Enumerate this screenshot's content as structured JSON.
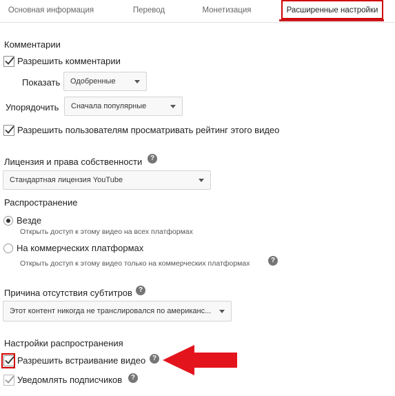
{
  "tabs": [
    {
      "label": "Основная информация"
    },
    {
      "label": "Перевод"
    },
    {
      "label": "Монетизация"
    },
    {
      "label": "Расширенные настройки"
    }
  ],
  "comments": {
    "heading": "Комментарии",
    "allow_label": "Разрешить комментарии",
    "allow_checked": true,
    "show_label": "Показать",
    "show_value": "Одобренные",
    "sort_label": "Упорядочить",
    "sort_value": "Сначала популярные",
    "rating_label": "Разрешить пользователям просматривать рейтинг этого видео",
    "rating_checked": true
  },
  "license": {
    "heading": "Лицензия и права собственности",
    "value": "Стандартная лицензия YouTube"
  },
  "distribution": {
    "heading": "Распространение",
    "everywhere_label": "Везде",
    "everywhere_desc": "Открыть доступ к этому видео на всех платформах",
    "commercial_label": "На коммерческих платформах",
    "commercial_desc": "Открыть доступ к этому видео только на коммерческих платформах",
    "selected": "everywhere"
  },
  "captions": {
    "heading": "Причина отсутствия субтитров",
    "value": "Этот контент никогда не транслировался по американс..."
  },
  "distribution_settings": {
    "heading": "Настройки распространения",
    "embed_label": "Разрешить встраивание видео",
    "embed_checked": true,
    "notify_label": "Уведомлять подписчиков",
    "notify_checked": true
  },
  "colors": {
    "accent_red": "#d10000",
    "arrow_red": "#e3141c",
    "check_color": "#333333"
  },
  "icons": [
    "help-icon",
    "checkmark-icon",
    "dropdown-arrow-icon",
    "red-arrow-icon"
  ]
}
